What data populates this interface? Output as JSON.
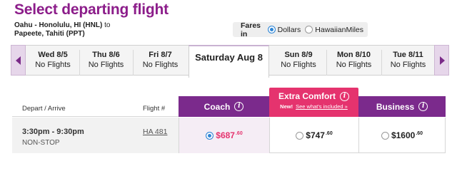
{
  "page": {
    "title": "Select departing flight",
    "route_line1": "Oahu - Honolulu, HI (HNL)",
    "route_to": " to",
    "route_line2": "Papeete, Tahiti (PPT)"
  },
  "fares": {
    "label": "Fares in",
    "options": [
      "Dollars",
      "HawaiianMiles"
    ],
    "selected": "Dollars"
  },
  "dates": [
    {
      "day": "Wed 8/5",
      "status": "No Flights"
    },
    {
      "day": "Thu 8/6",
      "status": "No Flights"
    },
    {
      "day": "Fri 8/7",
      "status": "No Flights"
    },
    {
      "day": "Saturday Aug 8",
      "status": ""
    },
    {
      "day": "Sun 8/9",
      "status": "No Flights"
    },
    {
      "day": "Mon 8/10",
      "status": "No Flights"
    },
    {
      "day": "Tue 8/11",
      "status": "No Flights"
    }
  ],
  "table": {
    "col_depart": "Depart / Arrive",
    "col_flight": "Flight #",
    "cabins": {
      "coach": "Coach",
      "extra_comfort": "Extra Comfort",
      "extra_new": "New!",
      "extra_link": "See what's included »",
      "business": "Business"
    },
    "info_glyph": "i"
  },
  "flight": {
    "time": "3:30pm - 9:30pm",
    "stops": "NON-STOP",
    "number": "HA 481",
    "prices": {
      "coach": {
        "dollars": "$687",
        "cents": ".60"
      },
      "extra_comfort": {
        "dollars": "$747",
        "cents": ".60"
      },
      "business": {
        "dollars": "$1600",
        "cents": ".60"
      }
    }
  },
  "colors": {
    "brand": "#8c1d8a",
    "cabin_header": "#7b2a8c",
    "accent_pink": "#e5336e",
    "radio_blue": "#2f86d6"
  }
}
